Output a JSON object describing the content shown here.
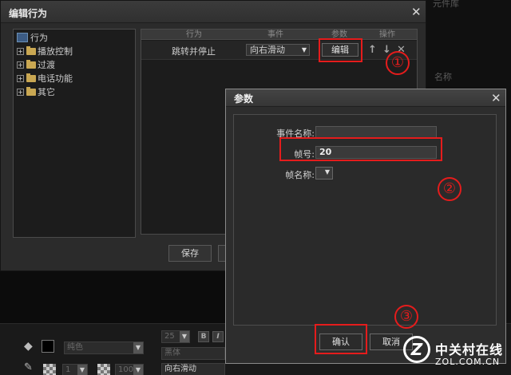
{
  "background": {
    "right_labels": [
      "元件库",
      "名称"
    ],
    "bottom": {
      "fill_select": "纯色",
      "stroke_width_select": "1",
      "opacity_select": "100",
      "font_size_select": "25",
      "bold_label": "B",
      "italic_label": "I",
      "font_select": "黑体",
      "text_value": "向右滑动"
    }
  },
  "edit_behavior": {
    "title": "编辑行为",
    "tree": {
      "root": "行为",
      "items": [
        "播放控制",
        "过渡",
        "电话功能",
        "其它"
      ]
    },
    "table": {
      "headers": [
        "行为",
        "事件",
        "参数",
        "操作"
      ],
      "rows": [
        {
          "action": "跳转并停止",
          "event": "向右滑动",
          "param_button": "编辑"
        }
      ]
    },
    "save_label": "保存"
  },
  "params_dialog": {
    "title": "参数",
    "fields": {
      "event_name_label": "事件名称:",
      "event_name_value": "",
      "frame_number_label": "帧号:",
      "frame_number_value": "20",
      "frame_name_label": "帧名称:"
    },
    "ok_label": "确认",
    "cancel_label": "取消"
  },
  "annotations": [
    "①",
    "②",
    "③"
  ],
  "watermark": {
    "cn": "中关村在线",
    "en": "ZOL.COM.CN"
  },
  "colors": {
    "highlight": "#e51c1c",
    "folder": "#c9a752"
  }
}
